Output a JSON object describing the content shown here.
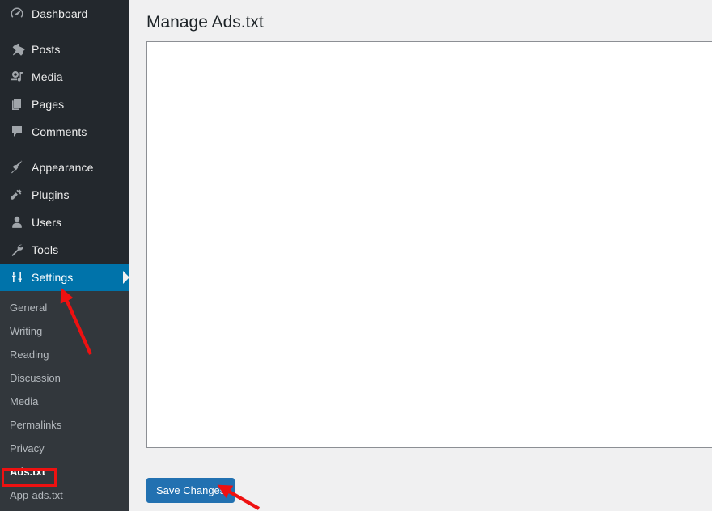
{
  "sidebar": {
    "items": [
      {
        "label": "Dashboard",
        "icon": "dashboard-icon",
        "current": false,
        "separator_after": true
      },
      {
        "label": "Posts",
        "icon": "pin-icon",
        "current": false,
        "separator_after": false
      },
      {
        "label": "Media",
        "icon": "media-icon",
        "current": false,
        "separator_after": false
      },
      {
        "label": "Pages",
        "icon": "pages-icon",
        "current": false,
        "separator_after": false
      },
      {
        "label": "Comments",
        "icon": "comment-icon",
        "current": false,
        "separator_after": true
      },
      {
        "label": "Appearance",
        "icon": "appearance-brush-icon",
        "current": false,
        "separator_after": false
      },
      {
        "label": "Plugins",
        "icon": "plugin-icon",
        "current": false,
        "separator_after": false
      },
      {
        "label": "Users",
        "icon": "user-icon",
        "current": false,
        "separator_after": false
      },
      {
        "label": "Tools",
        "icon": "wrench-icon",
        "current": false,
        "separator_after": false
      },
      {
        "label": "Settings",
        "icon": "settings-sliders-icon",
        "current": true,
        "separator_after": false
      }
    ],
    "submenu": [
      {
        "label": "General",
        "current": false
      },
      {
        "label": "Writing",
        "current": false
      },
      {
        "label": "Reading",
        "current": false
      },
      {
        "label": "Discussion",
        "current": false
      },
      {
        "label": "Media",
        "current": false
      },
      {
        "label": "Permalinks",
        "current": false
      },
      {
        "label": "Privacy",
        "current": false
      },
      {
        "label": "Ads.txt",
        "current": true
      },
      {
        "label": "App-ads.txt",
        "current": false
      }
    ]
  },
  "main": {
    "page_title": "Manage Ads.txt",
    "textarea_value": "",
    "textarea_placeholder": "",
    "save_label": "Save Changes"
  },
  "annotations": {
    "highlight_target": "Ads.txt",
    "arrow_settings_label": "arrow pointing to Settings menu item",
    "arrow_save_label": "arrow pointing to Save Changes button"
  },
  "colors": {
    "sidebar_bg": "#23282d",
    "submenu_bg": "#32373c",
    "accent_blue": "#0073aa",
    "button_blue": "#2271b1",
    "annotation_red": "#ee1111",
    "content_bg": "#f0f0f1"
  }
}
